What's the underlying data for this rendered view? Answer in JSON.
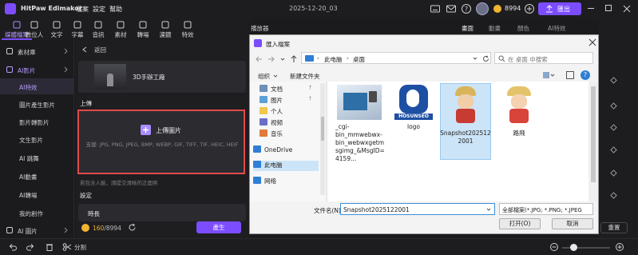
{
  "app": {
    "title": "HitPaw Edimakor",
    "project_name": "2025-12-20_03",
    "credits": "8994",
    "export_label": "匯出"
  },
  "menu": [
    "檔案",
    "設定",
    "幫助"
  ],
  "toolbar": [
    {
      "label": "媒體檔案",
      "icon": "media-icon"
    },
    {
      "label": "數位人",
      "icon": "avatar-icon"
    },
    {
      "label": "文字",
      "icon": "text-icon"
    },
    {
      "label": "字幕",
      "icon": "subtitle-icon"
    },
    {
      "label": "音訊",
      "icon": "audio-icon"
    },
    {
      "label": "素材",
      "icon": "material-icon"
    },
    {
      "label": "轉場",
      "icon": "transition-icon"
    },
    {
      "label": "濾鏡",
      "icon": "filter-icon"
    },
    {
      "label": "特效",
      "icon": "effects-icon"
    }
  ],
  "leftnav": {
    "items": [
      "素材庫",
      "AI影片",
      "AI特效",
      "圖片產生影片",
      "影片轉影片",
      "文生影片",
      "AI 跳舞",
      "AI動畫",
      "AI轉場",
      "我的創作",
      "AI 圖片"
    ]
  },
  "center": {
    "back_label": "返回",
    "template_title": "3D手辦工廠",
    "upload_heading": "上傳",
    "upload_button": "上傳圖片",
    "supported_formats": "支援: JPG, PNG, JPEG, BMP, WEBP, GIF, TIFF, TIF, HEIC, HEIF",
    "hint": "若包含人臉，請提交清晰的正面照",
    "settings_heading": "設定",
    "duration_label": "時長",
    "cost": "160",
    "balance": "/8994",
    "generate_label": "產生"
  },
  "player_label": "播放器",
  "dialog": {
    "title": "匯入檔案",
    "path": [
      "此电脑",
      "桌面"
    ],
    "search_placeholder": "在 桌面 中搜索",
    "organize_label": "组织",
    "new_folder_label": "新建文件夹",
    "tree": [
      "文档",
      "图片",
      "个人",
      "视频",
      "音乐",
      "OneDrive",
      "此电脑",
      "网络"
    ],
    "files": [
      {
        "name": "_cgi-bin_mmwebwx-bin_webwxgetmsgimg_&MsgID=4159..."
      },
      {
        "name": "logo",
        "logo_text": "HOSUNSEO"
      },
      {
        "name": "Snapshot2025122001"
      },
      {
        "name": "路飛"
      }
    ],
    "filename_label": "文件名(N):",
    "filename_value": "Snapshot2025122001",
    "filetype_value": "全部檔案(*.JPG; *.PNG; *.JPEG",
    "open_label": "打开(O)",
    "cancel_label": "取消"
  },
  "rightpanel": {
    "tabs": [
      "畫面",
      "動畫",
      "顏色",
      "AI特效"
    ],
    "reset_label": "重置"
  },
  "bottombar": {
    "split_label": "分割"
  },
  "colors": {
    "accent": "#7c4dff",
    "highlight_border": "#e24b4b",
    "selection": "#cce4f7"
  }
}
